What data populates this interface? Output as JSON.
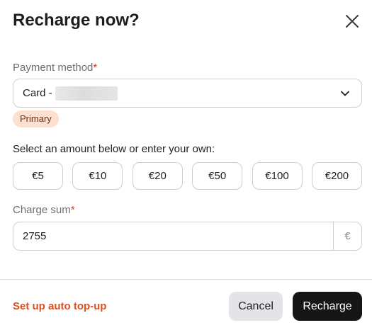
{
  "dialog": {
    "title": "Recharge now?",
    "close_icon": "close-icon"
  },
  "payment": {
    "label": "Payment method",
    "required_mark": "*",
    "selected_value": "Card -",
    "chevron_icon": "chevron-down-icon",
    "badge": "Primary"
  },
  "amounts": {
    "prompt": "Select an amount below or enter your own:",
    "options": [
      "€5",
      "€10",
      "€20",
      "€50",
      "€100",
      "€200"
    ]
  },
  "charge": {
    "label": "Charge sum",
    "required_mark": "*",
    "value": "2755",
    "currency_suffix": "€"
  },
  "footer": {
    "auto_topup_label": "Set up auto top-up",
    "cancel_label": "Cancel",
    "recharge_label": "Recharge"
  },
  "colors": {
    "accent_orange": "#e0501c",
    "required_red": "#d9361a",
    "badge_bg": "#fde0cf",
    "primary_button": "#161616",
    "secondary_button": "#e4e4e8"
  }
}
